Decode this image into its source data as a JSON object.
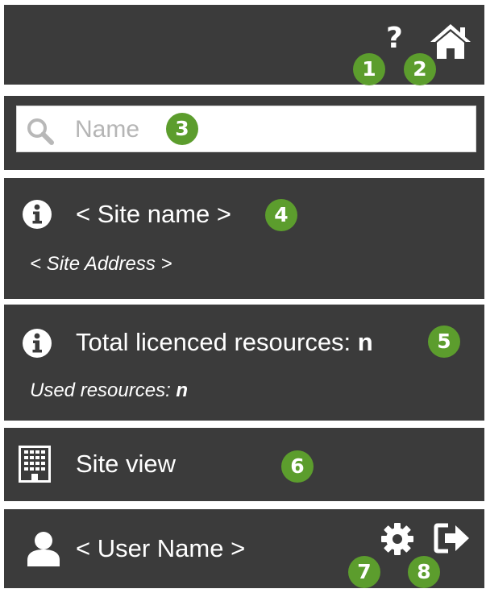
{
  "header": {
    "help_glyph": "?",
    "help_icon": "question-mark-icon",
    "home_icon": "home-icon",
    "badges": {
      "help": "1",
      "home": "2"
    }
  },
  "search": {
    "placeholder": "Name",
    "value": "",
    "icon": "search-icon",
    "badge": "3"
  },
  "site": {
    "name": "< Site name >",
    "address": "< Site Address >",
    "icon": "info-icon",
    "badge": "4"
  },
  "resources": {
    "total_label": "Total licenced resources: ",
    "total_value": "n",
    "used_label": "Used resources: ",
    "used_value": "n",
    "icon": "info-icon",
    "badge": "5"
  },
  "site_view": {
    "label": "Site view",
    "icon": "building-icon",
    "badge": "6"
  },
  "user": {
    "name": "< User Name >",
    "icon": "user-icon",
    "settings_icon": "gear-icon",
    "signout_icon": "sign-out-icon",
    "badges": {
      "settings": "7",
      "signout": "8"
    }
  },
  "colors": {
    "panel": "#3b3b3b",
    "badge": "#5c9d2d",
    "text": "#ffffff",
    "placeholder": "#b5b5b5"
  }
}
